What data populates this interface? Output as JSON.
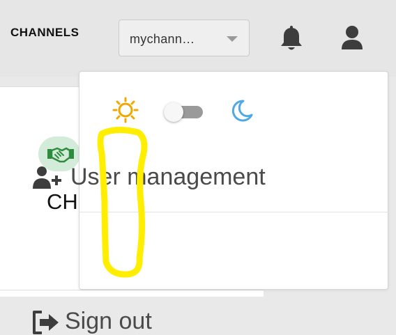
{
  "header": {
    "app_title": "CHANNELS",
    "channel_select": {
      "value": "mychann…",
      "arrow_icon": "caret-down-icon"
    },
    "notifications_icon": "bell-icon",
    "account_icon": "user-icon"
  },
  "content": {
    "card_icon": "handshake-icon",
    "card_label": "CH"
  },
  "dropdown": {
    "theme": {
      "light_icon": "sun-icon",
      "dark_icon": "moon-icon",
      "dark_mode_on": false
    },
    "items": [
      {
        "label": "User management",
        "icon": "user-plus-icon"
      },
      {
        "label": "Sign out",
        "icon": "sign-out-icon"
      }
    ]
  },
  "annotation": {
    "color": "#ffee00"
  },
  "colors": {
    "sun": "#f0a800",
    "moon": "#4fa9e6",
    "icon_dark": "#3d3d3d",
    "deal_green": "#2e8b3e",
    "deal_bg": "#d3ecd9"
  }
}
